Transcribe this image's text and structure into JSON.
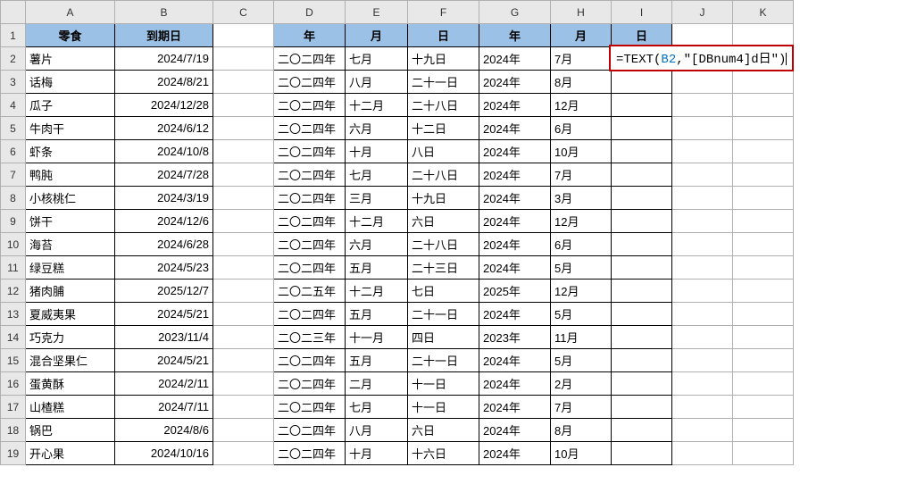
{
  "columns": [
    "A",
    "B",
    "C",
    "D",
    "E",
    "F",
    "G",
    "H",
    "I",
    "J",
    "K"
  ],
  "headers": {
    "A": "零食",
    "B": "到期日",
    "D": "年",
    "E": "月",
    "F": "日",
    "G": "年",
    "H": "月",
    "I": "日"
  },
  "formula": {
    "prefix": "=TEXT(",
    "ref": "B2",
    "suffix": ",\"[DBnum4]d日\")"
  },
  "rows": [
    {
      "a": "薯片",
      "b": "2024/7/19",
      "d": "二〇二四年",
      "e": "七月",
      "f": "十九日",
      "g": "2024年",
      "h": "7月"
    },
    {
      "a": "话梅",
      "b": "2024/8/21",
      "d": "二〇二四年",
      "e": "八月",
      "f": "二十一日",
      "g": "2024年",
      "h": "8月"
    },
    {
      "a": "瓜子",
      "b": "2024/12/28",
      "d": "二〇二四年",
      "e": "十二月",
      "f": "二十八日",
      "g": "2024年",
      "h": "12月"
    },
    {
      "a": "牛肉干",
      "b": "2024/6/12",
      "d": "二〇二四年",
      "e": "六月",
      "f": "十二日",
      "g": "2024年",
      "h": "6月"
    },
    {
      "a": "虾条",
      "b": "2024/10/8",
      "d": "二〇二四年",
      "e": "十月",
      "f": "八日",
      "g": "2024年",
      "h": "10月"
    },
    {
      "a": "鸭肫",
      "b": "2024/7/28",
      "d": "二〇二四年",
      "e": "七月",
      "f": "二十八日",
      "g": "2024年",
      "h": "7月"
    },
    {
      "a": "小核桃仁",
      "b": "2024/3/19",
      "d": "二〇二四年",
      "e": "三月",
      "f": "十九日",
      "g": "2024年",
      "h": "3月"
    },
    {
      "a": "饼干",
      "b": "2024/12/6",
      "d": "二〇二四年",
      "e": "十二月",
      "f": "六日",
      "g": "2024年",
      "h": "12月"
    },
    {
      "a": "海苔",
      "b": "2024/6/28",
      "d": "二〇二四年",
      "e": "六月",
      "f": "二十八日",
      "g": "2024年",
      "h": "6月"
    },
    {
      "a": "绿豆糕",
      "b": "2024/5/23",
      "d": "二〇二四年",
      "e": "五月",
      "f": "二十三日",
      "g": "2024年",
      "h": "5月"
    },
    {
      "a": "猪肉脯",
      "b": "2025/12/7",
      "d": "二〇二五年",
      "e": "十二月",
      "f": "七日",
      "g": "2025年",
      "h": "12月"
    },
    {
      "a": "夏威夷果",
      "b": "2024/5/21",
      "d": "二〇二四年",
      "e": "五月",
      "f": "二十一日",
      "g": "2024年",
      "h": "5月"
    },
    {
      "a": "巧克力",
      "b": "2023/11/4",
      "d": "二〇二三年",
      "e": "十一月",
      "f": "四日",
      "g": "2023年",
      "h": "11月"
    },
    {
      "a": "混合坚果仁",
      "b": "2024/5/21",
      "d": "二〇二四年",
      "e": "五月",
      "f": "二十一日",
      "g": "2024年",
      "h": "5月"
    },
    {
      "a": "蛋黄酥",
      "b": "2024/2/11",
      "d": "二〇二四年",
      "e": "二月",
      "f": "十一日",
      "g": "2024年",
      "h": "2月"
    },
    {
      "a": "山楂糕",
      "b": "2024/7/11",
      "d": "二〇二四年",
      "e": "七月",
      "f": "十一日",
      "g": "2024年",
      "h": "7月"
    },
    {
      "a": "锅巴",
      "b": "2024/8/6",
      "d": "二〇二四年",
      "e": "八月",
      "f": "六日",
      "g": "2024年",
      "h": "8月"
    },
    {
      "a": "开心果",
      "b": "2024/10/16",
      "d": "二〇二四年",
      "e": "十月",
      "f": "十六日",
      "g": "2024年",
      "h": "10月"
    }
  ]
}
